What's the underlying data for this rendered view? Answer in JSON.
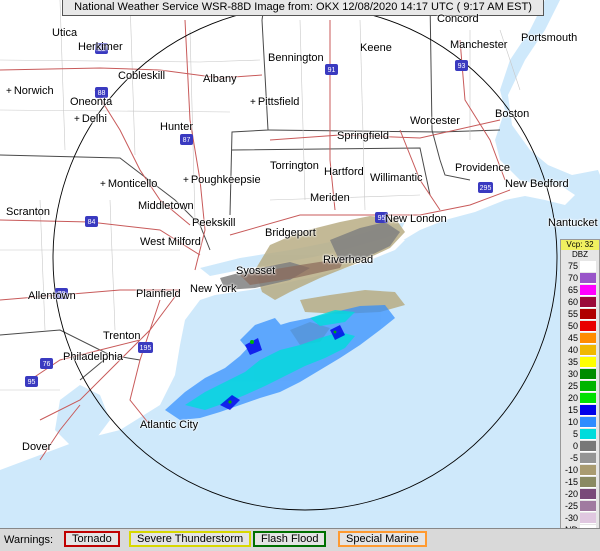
{
  "header": {
    "title": "National Weather Service WSR-88D Image from: OKX 12/08/2020 14:17 UTC ( 9:17 AM EST)"
  },
  "cities": [
    {
      "name": "Concord",
      "plus": false
    },
    {
      "name": "Utica",
      "plus": false
    },
    {
      "name": "Herkimer",
      "plus": false
    },
    {
      "name": "Bennington",
      "plus": false
    },
    {
      "name": "Keene",
      "plus": false
    },
    {
      "name": "Manchester",
      "plus": false
    },
    {
      "name": "Portsmouth",
      "plus": false
    },
    {
      "name": "Cobleskill",
      "plus": false
    },
    {
      "name": "Albany",
      "plus": false
    },
    {
      "name": "Norwich",
      "plus": true
    },
    {
      "name": "Oneonta",
      "plus": false
    },
    {
      "name": "Pittsfield",
      "plus": true
    },
    {
      "name": "Delhi",
      "plus": true
    },
    {
      "name": "Hunter",
      "plus": false
    },
    {
      "name": "Worcester",
      "plus": false
    },
    {
      "name": "Boston",
      "plus": false
    },
    {
      "name": "Springfield",
      "plus": false
    },
    {
      "name": "Torrington",
      "plus": false
    },
    {
      "name": "Hartford",
      "plus": false
    },
    {
      "name": "Willimantic",
      "plus": false
    },
    {
      "name": "Providence",
      "plus": false
    },
    {
      "name": "Monticello",
      "plus": true
    },
    {
      "name": "Poughkeepsie",
      "plus": true
    },
    {
      "name": "New Bedford",
      "plus": false
    },
    {
      "name": "Middletown",
      "plus": false
    },
    {
      "name": "Meriden",
      "plus": false
    },
    {
      "name": "New London",
      "plus": false
    },
    {
      "name": "Scranton",
      "plus": false
    },
    {
      "name": "Nantucket",
      "plus": false
    },
    {
      "name": "Peekskill",
      "plus": false
    },
    {
      "name": "West Milford",
      "plus": false
    },
    {
      "name": "Bridgeport",
      "plus": false
    },
    {
      "name": "Riverhead",
      "plus": false
    },
    {
      "name": "Syosset",
      "plus": false
    },
    {
      "name": "Allentown",
      "plus": false
    },
    {
      "name": "Plainfield",
      "plus": false
    },
    {
      "name": "New York",
      "plus": false
    },
    {
      "name": "Trenton",
      "plus": false
    },
    {
      "name": "Philadelphia",
      "plus": false
    },
    {
      "name": "Atlantic City",
      "plus": false
    },
    {
      "name": "Dover",
      "plus": false
    }
  ],
  "shields": [
    "90",
    "91",
    "93",
    "88",
    "87",
    "84",
    "95",
    "78",
    "76",
    "95",
    "195",
    "295"
  ],
  "legend": {
    "vcp_label": "Vcp: 32",
    "unit_label": "DBZ",
    "levels": [
      {
        "label": "75",
        "color": "#ffffff"
      },
      {
        "label": "70",
        "color": "#9955c9"
      },
      {
        "label": "65",
        "color": "#ff00ff"
      },
      {
        "label": "60",
        "color": "#9a0a3a"
      },
      {
        "label": "55",
        "color": "#b00000"
      },
      {
        "label": "50",
        "color": "#e80000"
      },
      {
        "label": "45",
        "color": "#ff8c00"
      },
      {
        "label": "40",
        "color": "#f0b800"
      },
      {
        "label": "35",
        "color": "#ffff00"
      },
      {
        "label": "30",
        "color": "#008c00"
      },
      {
        "label": "25",
        "color": "#00b400"
      },
      {
        "label": "20",
        "color": "#00e000"
      },
      {
        "label": "15",
        "color": "#0000e8"
      },
      {
        "label": "10",
        "color": "#2e8cff"
      },
      {
        "label": "5",
        "color": "#00dcdc"
      },
      {
        "label": "0",
        "color": "#787878"
      },
      {
        "label": "-5",
        "color": "#959595"
      },
      {
        "label": "-10",
        "color": "#a99b70"
      },
      {
        "label": "-15",
        "color": "#8a8a62"
      },
      {
        "label": "-20",
        "color": "#7a4a7a"
      },
      {
        "label": "-25",
        "color": "#a07aa0"
      },
      {
        "label": "-30",
        "color": "#e0c8e0"
      },
      {
        "label": "ND",
        "color": "#ffffff"
      }
    ]
  },
  "warnings": {
    "label": "Warnings:",
    "items": [
      {
        "label": "Tornado",
        "color": "#c00000"
      },
      {
        "label": "Severe Thunderstorm",
        "color": "#d8d800"
      },
      {
        "label": "Flash Flood",
        "color": "#007000"
      },
      {
        "label": "Special Marine",
        "color": "#ff9a30"
      }
    ]
  },
  "colors": {
    "water": "#cfe9fb",
    "land": "#ffffff",
    "range_ring": "#000000"
  }
}
